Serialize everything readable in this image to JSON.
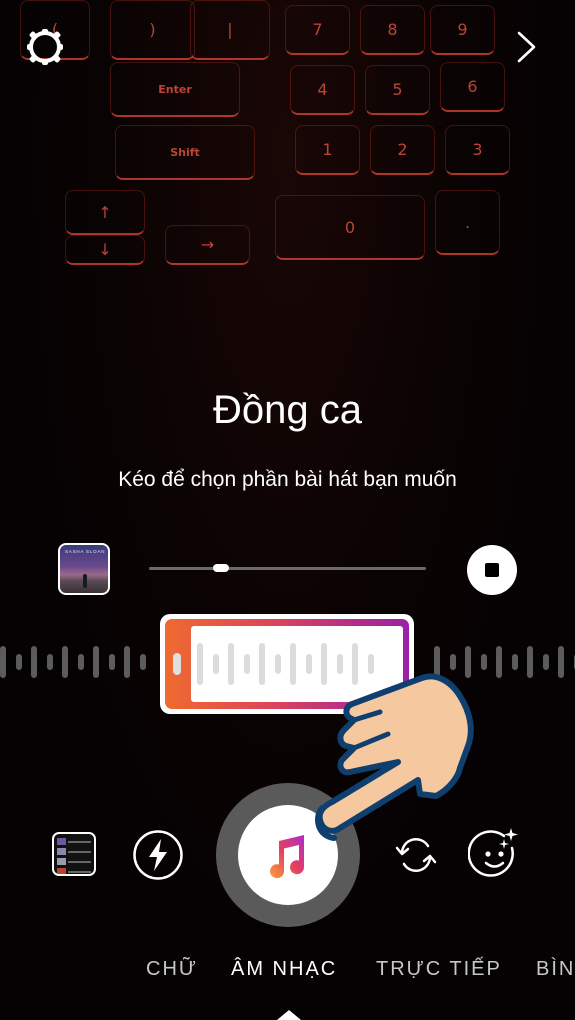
{
  "camera": {
    "background_description": "dim backlit laptop keyboard",
    "keys": [
      "(",
      ")",
      "|",
      "7",
      "8",
      "9",
      "Enter",
      "4",
      "5",
      "6",
      "Shift",
      "1",
      "2",
      "3",
      "↑",
      "↓",
      "→",
      "0",
      "."
    ]
  },
  "top_bar": {
    "settings_icon": "gear-icon",
    "next_icon": "chevron-right-icon"
  },
  "music": {
    "song_title": "Đồng ca",
    "instruction": "Kéo để chọn phần bài hát bạn muốn",
    "album_artist_text": "SASHA SLOAN",
    "playback_progress": 0.26,
    "stop_icon": "stop-icon"
  },
  "waveform": {
    "selection_start": 0.28,
    "selection_end": 0.72
  },
  "controls": {
    "gallery_icon": "gallery-thumbnail",
    "flash_icon": "flash-icon",
    "capture_icon": "music-note-icon",
    "flip_icon": "flip-camera-icon",
    "effects_icon": "face-effects-icon"
  },
  "modes": {
    "tabs": [
      {
        "label": "CHỮ",
        "active": false
      },
      {
        "label": "ÂM NHẠC",
        "active": true
      },
      {
        "label": "TRỰC TIẾP",
        "active": false
      },
      {
        "label": "BÌN",
        "active": false
      }
    ]
  },
  "colors": {
    "gradient_start": "#ef6a2f",
    "gradient_mid": "#d9455a",
    "gradient_end": "#9a22a8",
    "hand_fill": "#f6c8a0",
    "hand_stroke": "#0f3f6e"
  }
}
